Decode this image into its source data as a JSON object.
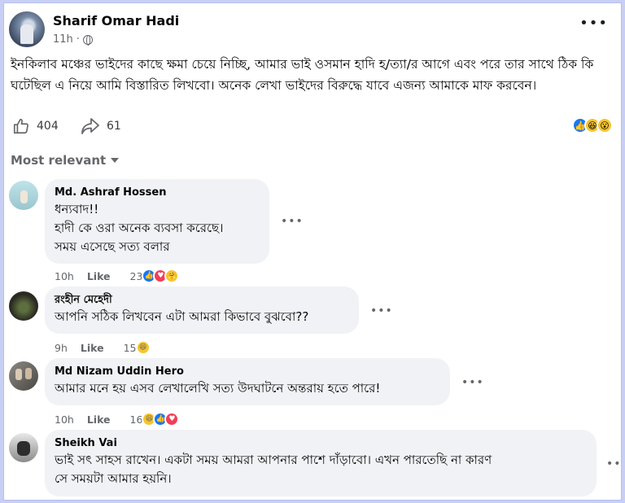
{
  "post": {
    "author": "Sharif Omar Hadi",
    "time": "11h",
    "dot": "·",
    "text": "ইনকিলাব মঞ্চের ভাইদের কাছে ক্ষমা চেয়ে নিচ্ছি, আমার ভাই ওসমান হাদি হ/ত্যা/র আগে এবং পরে তার সাথে ঠিক কি ঘটেছিল এ নিয়ে আমি বিস্তারিত লিখবো। অনেক লেখা ভাইদের বিরুদ্ধে যাবে এজন্য আমাকে মাফ করবেন।",
    "likes": "404",
    "shares": "61",
    "reactions": [
      "like-icon",
      "haha-icon",
      "wow-icon"
    ]
  },
  "sort_label": "Most relevant",
  "comments": [
    {
      "name": "Md. Ashraf Hossen",
      "text": "ধন্যবাদ!!\nহাদী কে ওরা অনেক ব্যবসা করেছে।\nসময় এসেছে সত্য বলার",
      "time": "10h",
      "like": "Like",
      "count": "23",
      "reactions": [
        "like-icon",
        "love-icon",
        "care-icon"
      ]
    },
    {
      "name": "রংহীন মেহেদী",
      "text": "আপনি সঠিক লিখবেন এটা আমরা কিভাবে বুঝবো??",
      "time": "9h",
      "like": "Like",
      "count": "15",
      "reactions": [
        "haha-icon"
      ]
    },
    {
      "name": "Md Nizam Uddin Hero",
      "text": "আমার মনে হয় এসব লেখালেখি সত্য উদঘাটনে অন্তরায় হতে পারে!",
      "time": "10h",
      "like": "Like",
      "count": "16",
      "reactions": [
        "haha-icon",
        "like-icon",
        "love-icon"
      ]
    },
    {
      "name": "Sheikh Vai",
      "text": "ভাই সৎ সাহস রাখেন। একটা সময় আমরা আপনার পাশে দাঁড়াবো। এখন পারতেছি না কারণ\nসে সময়টা আমার হয়নি।",
      "time": "",
      "like": "",
      "count": "",
      "reactions": []
    }
  ],
  "colors": {
    "like": "#1877f2",
    "love": "#f33e58",
    "haha": "#f7c52d",
    "bubble": "#f0f2f5",
    "meta": "#65676b"
  }
}
